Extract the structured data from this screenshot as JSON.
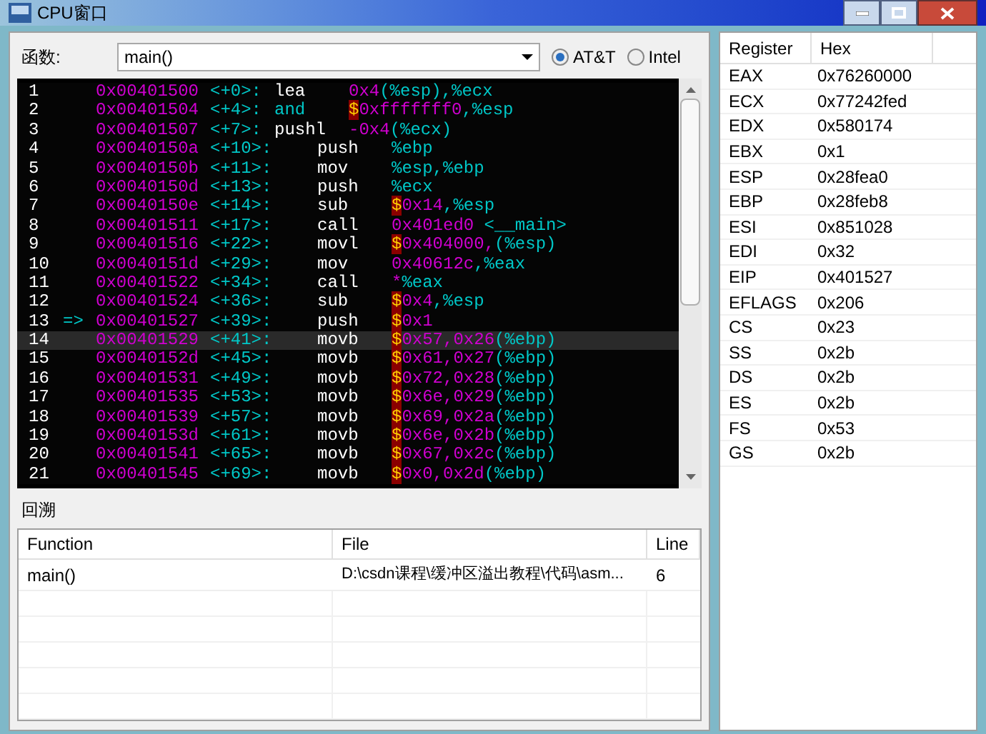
{
  "window": {
    "title": "CPU窗口"
  },
  "toolbar": {
    "label": "函数:",
    "function_value": "main()",
    "syntax": [
      {
        "label": "AT&T",
        "selected": true
      },
      {
        "label": "Intel",
        "selected": false
      }
    ]
  },
  "disassembly": [
    {
      "line": "1",
      "address": "0x00401500",
      "offset": "<+0>:",
      "kind": "entry",
      "selected": false,
      "mnemonic": {
        "text": "lea",
        "kind": "plain"
      },
      "operands": [
        {
          "text": "0x4",
          "kind": "num"
        },
        {
          "text": "(%esp),%ecx",
          "kind": "reg"
        }
      ]
    },
    {
      "line": "2",
      "address": "0x00401504",
      "offset": "<+4>:",
      "kind": "entry",
      "selected": false,
      "mnemonic": {
        "text": "and",
        "kind": "reg"
      },
      "operands": [
        {
          "text": "$",
          "kind": "dollar"
        },
        {
          "text": "0xfffffff0",
          "kind": "num"
        },
        {
          "text": ",%esp",
          "kind": "reg"
        }
      ]
    },
    {
      "line": "3",
      "address": "0x00401507",
      "offset": "<+7>:",
      "kind": "entry",
      "selected": false,
      "mnemonic": {
        "text": "pushl",
        "kind": "plain"
      },
      "operands": [
        {
          "text": "-0x4",
          "kind": "num"
        },
        {
          "text": "(%ecx)",
          "kind": "reg"
        }
      ]
    },
    {
      "line": "4",
      "address": "0x0040150a",
      "offset": "<+10>:",
      "kind": "body",
      "selected": false,
      "mnemonic": {
        "text": "push",
        "kind": "plain"
      },
      "operands": [
        {
          "text": "%ebp",
          "kind": "reg"
        }
      ]
    },
    {
      "line": "5",
      "address": "0x0040150b",
      "offset": "<+11>:",
      "kind": "body",
      "selected": false,
      "mnemonic": {
        "text": "mov",
        "kind": "plain"
      },
      "operands": [
        {
          "text": "%esp,%ebp",
          "kind": "reg"
        }
      ]
    },
    {
      "line": "6",
      "address": "0x0040150d",
      "offset": "<+13>:",
      "kind": "body",
      "selected": false,
      "mnemonic": {
        "text": "push",
        "kind": "plain"
      },
      "operands": [
        {
          "text": "%ecx",
          "kind": "reg"
        }
      ]
    },
    {
      "line": "7",
      "address": "0x0040150e",
      "offset": "<+14>:",
      "kind": "body",
      "selected": false,
      "mnemonic": {
        "text": "sub",
        "kind": "plain"
      },
      "operands": [
        {
          "text": "$",
          "kind": "dollar"
        },
        {
          "text": "0x14",
          "kind": "num"
        },
        {
          "text": ",%esp",
          "kind": "reg"
        }
      ]
    },
    {
      "line": "8",
      "address": "0x00401511",
      "offset": "<+17>:",
      "kind": "body",
      "selected": false,
      "mnemonic": {
        "text": "call",
        "kind": "plain"
      },
      "operands": [
        {
          "text": "0x401ed0",
          "kind": "num"
        },
        {
          "text": " <__main>",
          "kind": "reg"
        }
      ]
    },
    {
      "line": "9",
      "address": "0x00401516",
      "offset": "<+22>:",
      "kind": "body",
      "selected": false,
      "mnemonic": {
        "text": "movl",
        "kind": "plain"
      },
      "operands": [
        {
          "text": "$",
          "kind": "dollar"
        },
        {
          "text": "0x404000,",
          "kind": "num"
        },
        {
          "text": "(%esp)",
          "kind": "reg"
        }
      ]
    },
    {
      "line": "10",
      "address": "0x0040151d",
      "offset": "<+29>:",
      "kind": "body",
      "selected": false,
      "mnemonic": {
        "text": "mov",
        "kind": "plain"
      },
      "operands": [
        {
          "text": "0x40612c",
          "kind": "num"
        },
        {
          "text": ",%eax",
          "kind": "reg"
        }
      ]
    },
    {
      "line": "11",
      "address": "0x00401522",
      "offset": "<+34>:",
      "kind": "body",
      "selected": false,
      "mnemonic": {
        "text": "call",
        "kind": "plain"
      },
      "operands": [
        {
          "text": "*",
          "kind": "num"
        },
        {
          "text": "%eax",
          "kind": "reg"
        }
      ]
    },
    {
      "line": "12",
      "address": "0x00401524",
      "offset": "<+36>:",
      "kind": "body",
      "selected": false,
      "mnemonic": {
        "text": "sub",
        "kind": "plain"
      },
      "operands": [
        {
          "text": "$",
          "kind": "dollar"
        },
        {
          "text": "0x4",
          "kind": "num"
        },
        {
          "text": ",%esp",
          "kind": "reg"
        }
      ]
    },
    {
      "line": "13",
      "marker": "=>",
      "address": "0x00401527",
      "offset": "<+39>:",
      "kind": "body",
      "selected": false,
      "mnemonic": {
        "text": "push",
        "kind": "plain"
      },
      "operands": [
        {
          "text": "$",
          "kind": "dollar"
        },
        {
          "text": "0x1",
          "kind": "num"
        }
      ]
    },
    {
      "line": "14",
      "address": "0x00401529",
      "offset": "<+41>:",
      "kind": "body",
      "selected": true,
      "mnemonic": {
        "text": "movb",
        "kind": "plain"
      },
      "operands": [
        {
          "text": "$",
          "kind": "dollar"
        },
        {
          "text": "0x57,0x26",
          "kind": "num"
        },
        {
          "text": "(%ebp)",
          "kind": "reg"
        }
      ]
    },
    {
      "line": "15",
      "address": "0x0040152d",
      "offset": "<+45>:",
      "kind": "body",
      "selected": false,
      "mnemonic": {
        "text": "movb",
        "kind": "plain"
      },
      "operands": [
        {
          "text": "$",
          "kind": "dollar"
        },
        {
          "text": "0x61,0x27",
          "kind": "num"
        },
        {
          "text": "(%ebp)",
          "kind": "reg"
        }
      ]
    },
    {
      "line": "16",
      "address": "0x00401531",
      "offset": "<+49>:",
      "kind": "body",
      "selected": false,
      "mnemonic": {
        "text": "movb",
        "kind": "plain"
      },
      "operands": [
        {
          "text": "$",
          "kind": "dollar"
        },
        {
          "text": "0x72,0x28",
          "kind": "num"
        },
        {
          "text": "(%ebp)",
          "kind": "reg"
        }
      ]
    },
    {
      "line": "17",
      "address": "0x00401535",
      "offset": "<+53>:",
      "kind": "body",
      "selected": false,
      "mnemonic": {
        "text": "movb",
        "kind": "plain"
      },
      "operands": [
        {
          "text": "$",
          "kind": "dollar"
        },
        {
          "text": "0x6e,0x29",
          "kind": "num"
        },
        {
          "text": "(%ebp)",
          "kind": "reg"
        }
      ]
    },
    {
      "line": "18",
      "address": "0x00401539",
      "offset": "<+57>:",
      "kind": "body",
      "selected": false,
      "mnemonic": {
        "text": "movb",
        "kind": "plain"
      },
      "operands": [
        {
          "text": "$",
          "kind": "dollar"
        },
        {
          "text": "0x69,0x2a",
          "kind": "num"
        },
        {
          "text": "(%ebp)",
          "kind": "reg"
        }
      ]
    },
    {
      "line": "19",
      "address": "0x0040153d",
      "offset": "<+61>:",
      "kind": "body",
      "selected": false,
      "mnemonic": {
        "text": "movb",
        "kind": "plain"
      },
      "operands": [
        {
          "text": "$",
          "kind": "dollar"
        },
        {
          "text": "0x6e,0x2b",
          "kind": "num"
        },
        {
          "text": "(%ebp)",
          "kind": "reg"
        }
      ]
    },
    {
      "line": "20",
      "address": "0x00401541",
      "offset": "<+65>:",
      "kind": "body",
      "selected": false,
      "mnemonic": {
        "text": "movb",
        "kind": "plain"
      },
      "operands": [
        {
          "text": "$",
          "kind": "dollar"
        },
        {
          "text": "0x67,0x2c",
          "kind": "num"
        },
        {
          "text": "(%ebp)",
          "kind": "reg"
        }
      ]
    },
    {
      "line": "21",
      "address": "0x00401545",
      "offset": "<+69>:",
      "kind": "body",
      "selected": false,
      "mnemonic": {
        "text": "movb",
        "kind": "plain"
      },
      "operands": [
        {
          "text": "$",
          "kind": "dollar"
        },
        {
          "text": "0x0,0x2d",
          "kind": "num"
        },
        {
          "text": "(%ebp)",
          "kind": "reg"
        }
      ]
    }
  ],
  "backtrace": {
    "label": "回溯",
    "columns": [
      "Function",
      "File",
      "Line"
    ],
    "rows": [
      {
        "function": "main()",
        "file": "D:\\csdn课程\\缓冲区溢出教程\\代码\\asm...",
        "line": "6"
      }
    ]
  },
  "registers": {
    "columns": [
      "Register",
      "Hex"
    ],
    "rows": [
      {
        "name": "EAX",
        "value": "0x76260000"
      },
      {
        "name": "ECX",
        "value": "0x77242fed"
      },
      {
        "name": "EDX",
        "value": "0x580174"
      },
      {
        "name": "EBX",
        "value": "0x1"
      },
      {
        "name": "ESP",
        "value": "0x28fea0"
      },
      {
        "name": "EBP",
        "value": "0x28feb8"
      },
      {
        "name": "ESI",
        "value": "0x851028"
      },
      {
        "name": "EDI",
        "value": "0x32"
      },
      {
        "name": "EIP",
        "value": "0x401527"
      },
      {
        "name": "EFLAGS",
        "value": "0x206"
      },
      {
        "name": "CS",
        "value": "0x23"
      },
      {
        "name": "SS",
        "value": "0x2b"
      },
      {
        "name": "DS",
        "value": "0x2b"
      },
      {
        "name": "ES",
        "value": "0x2b"
      },
      {
        "name": "FS",
        "value": "0x53"
      },
      {
        "name": "GS",
        "value": "0x2b"
      }
    ]
  }
}
